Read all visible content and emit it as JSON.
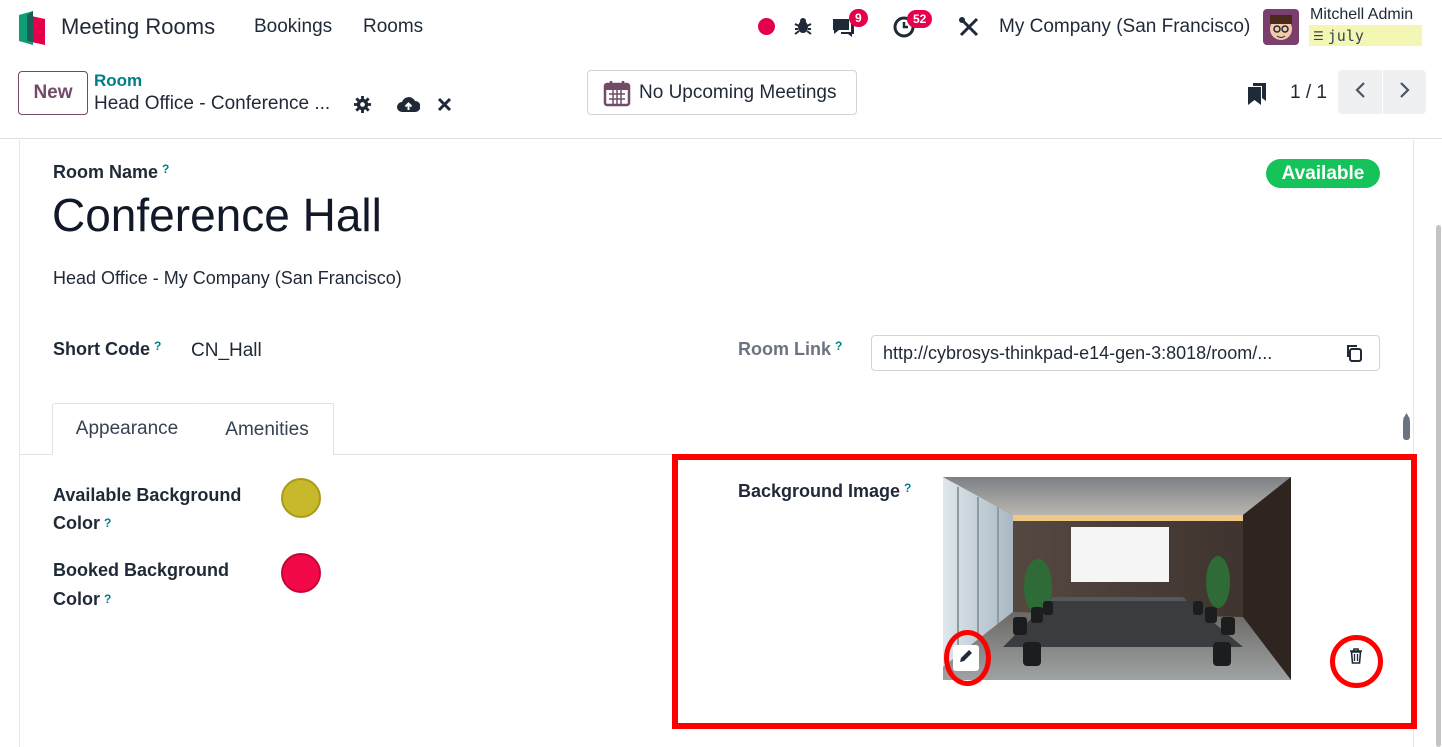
{
  "topbar": {
    "app_name": "Meeting Rooms",
    "menu": [
      "Bookings",
      "Rooms"
    ],
    "messages_count": "9",
    "activities_count": "52",
    "company": "My Company (San Francisco)",
    "user_name": "Mitchell Admin",
    "db_name": "july"
  },
  "control_panel": {
    "new_label": "New",
    "breadcrumb_parent": "Room",
    "breadcrumb_current": "Head Office - Conference ...",
    "meetings_button": "No Upcoming Meetings",
    "pager": "1 / 1"
  },
  "form": {
    "room_name_label": "Room Name",
    "room_name": "Conference Hall",
    "status": "Available",
    "office": "Head Office - My Company (San Francisco)",
    "short_code_label": "Short Code",
    "short_code": "CN_Hall",
    "room_link_label": "Room Link",
    "room_link": "http://cybrosys-thinkpad-e14-gen-3:8018/room/...",
    "help_mark": "?"
  },
  "tabs": [
    "Appearance",
    "Amenities"
  ],
  "appearance": {
    "available_bg_label_1": "Available Background",
    "available_bg_label_2": "Color",
    "available_bg_color": "#c8b82c",
    "booked_bg_label_1": "Booked Background",
    "booked_bg_label_2": "Color",
    "booked_bg_color": "#f30848",
    "background_image_label": "Background Image"
  },
  "colors": {
    "brand": "#714b67",
    "link": "#017e84",
    "success": "#16c35a",
    "badge": "#e6004c",
    "highlight": "#ff0000"
  }
}
